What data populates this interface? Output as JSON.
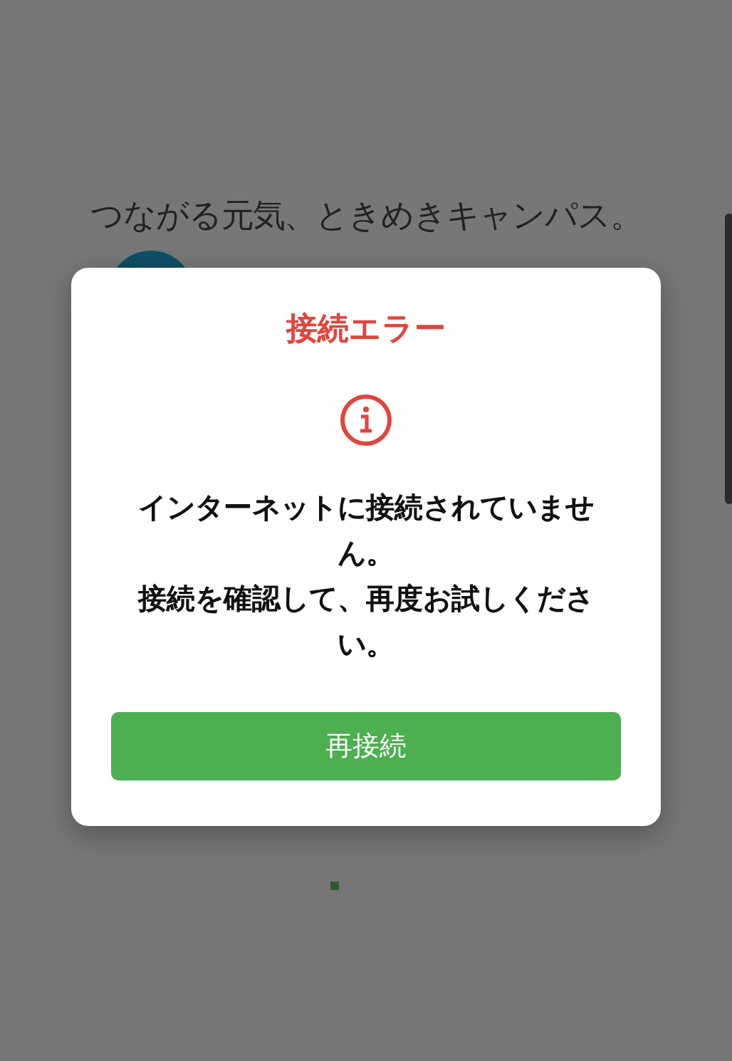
{
  "background": {
    "headline": "つながる元気、ときめきキャンパス。"
  },
  "dialog": {
    "title": "接続エラー",
    "messages": [
      "インターネットに接続されていません。",
      "接続を確認して、再度お試しください。"
    ],
    "button": "再接続"
  }
}
